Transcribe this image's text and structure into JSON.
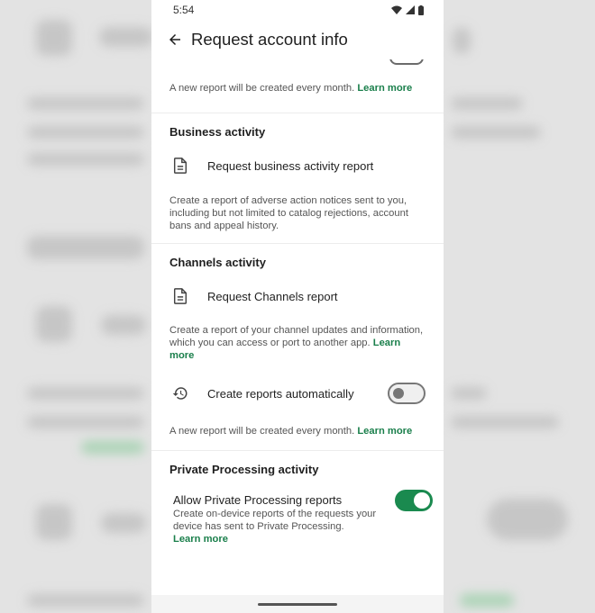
{
  "status_bar": {
    "time": "5:54"
  },
  "app_bar": {
    "title": "Request account info"
  },
  "account_info": {
    "description": "A new report will be created every month.",
    "learn_more": "Learn more"
  },
  "business": {
    "title": "Business activity",
    "request_label": "Request business activity report",
    "description": "Create a report of adverse action notices sent to you, including but not limited to catalog rejections, account bans and appeal history."
  },
  "channels": {
    "title": "Channels activity",
    "request_label": "Request Channels report",
    "description": "Create a report of your channel updates and information, which you can access or port to another app.",
    "learn_more": "Learn more",
    "auto_label": "Create reports automatically",
    "auto_enabled": false,
    "auto_description": "A new report will be created every month.",
    "auto_learn_more": "Learn more"
  },
  "private_processing": {
    "title": "Private Processing activity",
    "allow_label": "Allow Private Processing reports",
    "allow_enabled": true,
    "description": "Create on-device reports of the requests your device has sent to Private Processing.",
    "learn_more": "Learn more"
  },
  "colors": {
    "accent": "#1a7f4b",
    "toggle_on": "#1a8a4f"
  },
  "icons": [
    "back-arrow-icon",
    "document-icon",
    "history-icon",
    "wifi-icon",
    "signal-icon",
    "battery-icon"
  ]
}
